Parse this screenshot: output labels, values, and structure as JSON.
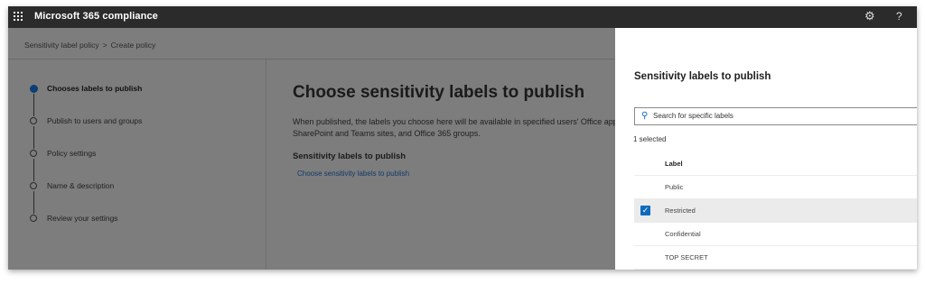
{
  "app": {
    "title": "Microsoft 365 compliance"
  },
  "topbar": {
    "settings_icon": "gear-icon",
    "help_icon": "help-icon",
    "help_text": "?"
  },
  "breadcrumb": {
    "items": [
      "Sensitivity label policy",
      "Create policy"
    ],
    "separator": ">"
  },
  "wizard": {
    "steps": [
      {
        "label": "Chooses labels to publish",
        "active": true
      },
      {
        "label": "Publish to users and groups",
        "active": false
      },
      {
        "label": "Policy settings",
        "active": false
      },
      {
        "label": "Name & description",
        "active": false
      },
      {
        "label": "Review your settings",
        "active": false
      }
    ]
  },
  "main": {
    "heading": "Choose sensitivity labels to publish",
    "description_line1": "When published, the labels you choose here will be available in specified users' Office apps,",
    "description_line2": "SharePoint and Teams sites, and Office 365 groups.",
    "section_title": "Sensitivity labels to publish",
    "section_link": "Choose sensitivity labels to publish"
  },
  "panel": {
    "title": "Sensitivity labels to publish",
    "search_placeholder": "Search for specific labels",
    "selected_count": "1 selected",
    "column_header": "Label",
    "labels": [
      {
        "name": "Public",
        "selected": false
      },
      {
        "name": "Restricted",
        "selected": true
      },
      {
        "name": "Confidential",
        "selected": false
      },
      {
        "name": "TOP SECRET",
        "selected": false
      }
    ]
  },
  "colors": {
    "topbar": "#2b2b2b",
    "accent": "#0f6cbd",
    "overlay": "#7d7d7d",
    "active_step": "#0b3e77"
  }
}
